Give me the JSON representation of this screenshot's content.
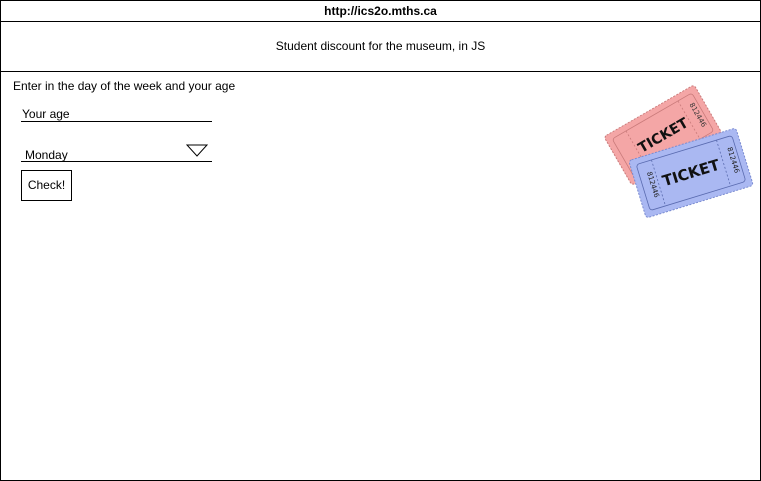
{
  "url": "http://ics2o.mths.ca",
  "header": {
    "title": "Student discount for the museum, in JS"
  },
  "form": {
    "instructions": "Enter in the day of the week and your age",
    "age_placeholder": "Your age",
    "age_value": "",
    "day_selected": "Monday",
    "check_label": "Check!"
  },
  "image": {
    "ticket_word": "TICKET",
    "ticket_serial": "812446",
    "colors": {
      "red_ticket": "#f4a6a6",
      "blue_ticket": "#aab8f2"
    }
  }
}
